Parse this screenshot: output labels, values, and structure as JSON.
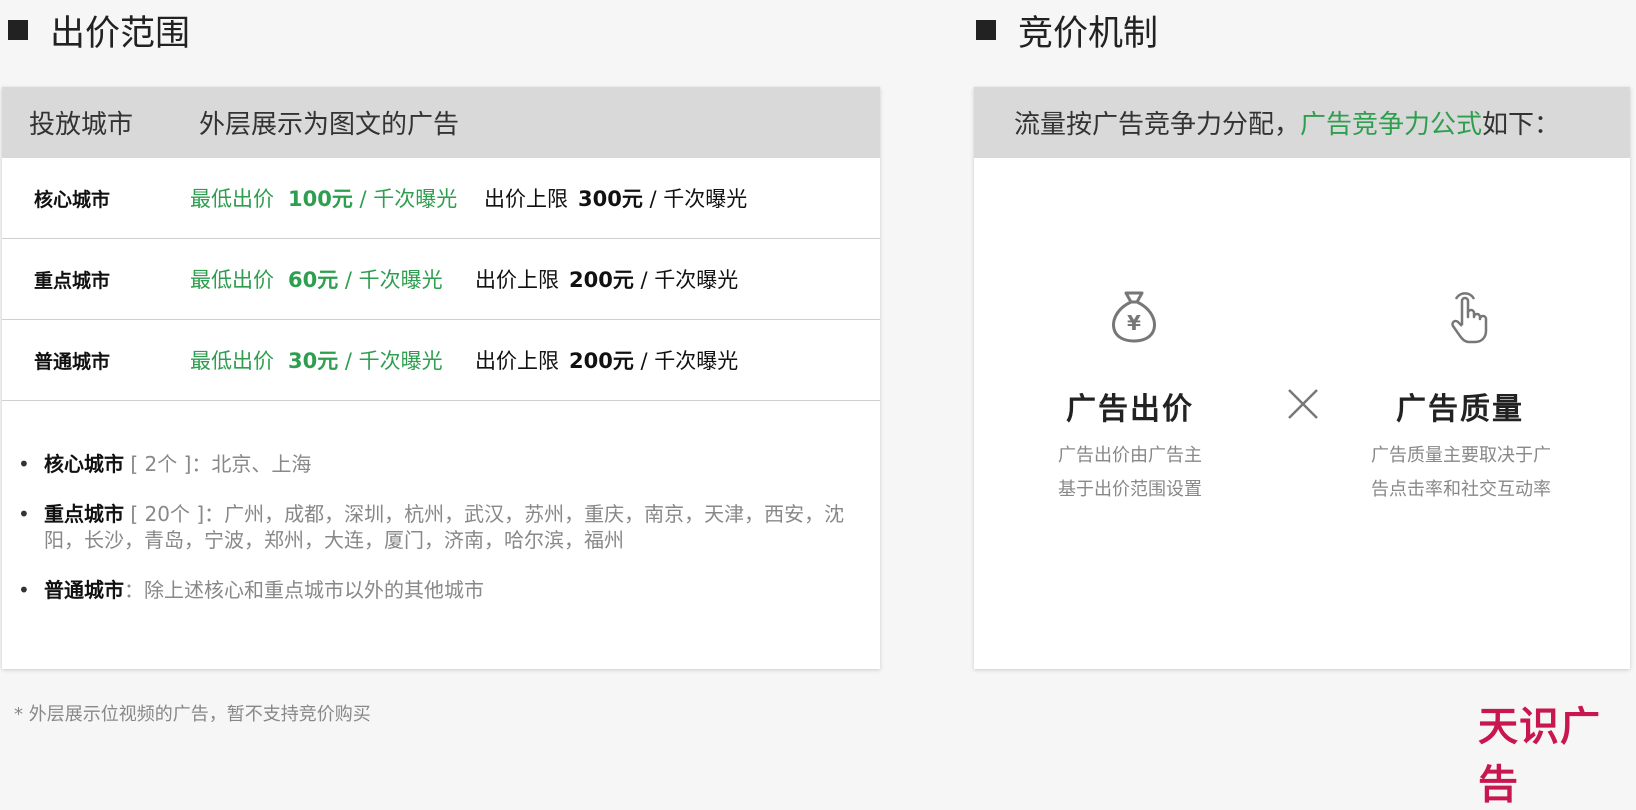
{
  "left": {
    "title": "出价范围",
    "header": {
      "col1": "投放城市",
      "col2": "外层展示为图文的广告"
    },
    "rows": [
      {
        "city": "核心城市",
        "min_label": "最低出价",
        "min_value": "100元",
        "min_unit": " / 千次曝光",
        "max_label": "出价上限",
        "max_value": "300元",
        "max_unit": " / 千次曝光"
      },
      {
        "city": "重点城市",
        "min_label": "最低出价",
        "min_value": "60元",
        "min_unit": " / 千次曝光",
        "max_label": "出价上限",
        "max_value": "200元",
        "max_unit": " / 千次曝光"
      },
      {
        "city": "普通城市",
        "min_label": "最低出价",
        "min_value": "30元",
        "min_unit": " / 千次曝光",
        "max_label": "出价上限",
        "max_value": "200元",
        "max_unit": " / 千次曝光"
      }
    ],
    "list": [
      {
        "bold": "核心城市",
        "text": " [ 2个 ]：北京、上海"
      },
      {
        "bold": "重点城市",
        "text": " [ 20个 ]：广州，成都，深圳，杭州，武汉，苏州，重庆，南京，天津，西安，沈阳，长沙，青岛，宁波，郑州，大连，厦门，济南，哈尔滨，福州"
      },
      {
        "bold": "普通城市",
        "text": "：除上述核心和重点城市以外的其他城市"
      }
    ]
  },
  "right": {
    "title": "竞价机制",
    "header": {
      "pre": "流量按广告竞争力分配，",
      "highlight": "广告竞争力公式",
      "post": "如下："
    },
    "features": [
      {
        "icon": "money-bag-icon",
        "title": "广告出价",
        "desc_line1": "广告出价由广告主",
        "desc_line2": "基于出价范围设置"
      },
      {
        "icon": "hand-tap-icon",
        "title": "广告质量",
        "desc_line1": "广告质量主要取决于广",
        "desc_line2": "告点击率和社交互动率"
      }
    ],
    "operator_icon": "multiply-icon"
  },
  "footnote": "* 外层展示位视频的广告，暂不支持竞价购买",
  "brand": "天识广告",
  "colors": {
    "green": "#2e9e4f",
    "brand": "#c8164f",
    "header_bg": "#d9d9d9"
  }
}
